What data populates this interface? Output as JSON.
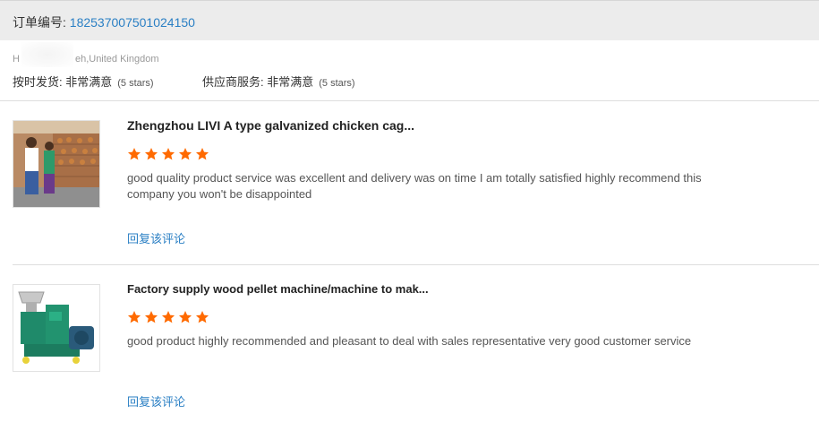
{
  "order": {
    "label": "订单编号: ",
    "number": "182537007501024150"
  },
  "buyer": {
    "name_start": "H",
    "name_end": "eh,United Kingdom"
  },
  "ratings": {
    "delivery_label": "按时发货: ",
    "delivery_value": "非常满意",
    "delivery_stars": "(5 stars)",
    "service_label": "供应商服务: ",
    "service_value": "非常满意",
    "service_stars": "(5 stars)"
  },
  "reviews": [
    {
      "title": "Zhengzhou LIVI A type galvanized chicken cag...",
      "rating": 5,
      "text": "good quality product service was excellent and delivery was on time I am totally satisfied highly recommend this company you won't be disappointed",
      "reply": "回复该评论",
      "image": "chicken-cage-photo"
    },
    {
      "title": "Factory supply wood pellet machine/machine to mak...",
      "rating": 5,
      "text": "good product highly recommended and pleasant to deal with sales representative very good customer service",
      "reply": "回复该评论",
      "image": "pellet-machine-photo"
    }
  ],
  "colors": {
    "link": "#2a7fc4",
    "star": "#ff6a00",
    "header_bg": "#ececec"
  }
}
